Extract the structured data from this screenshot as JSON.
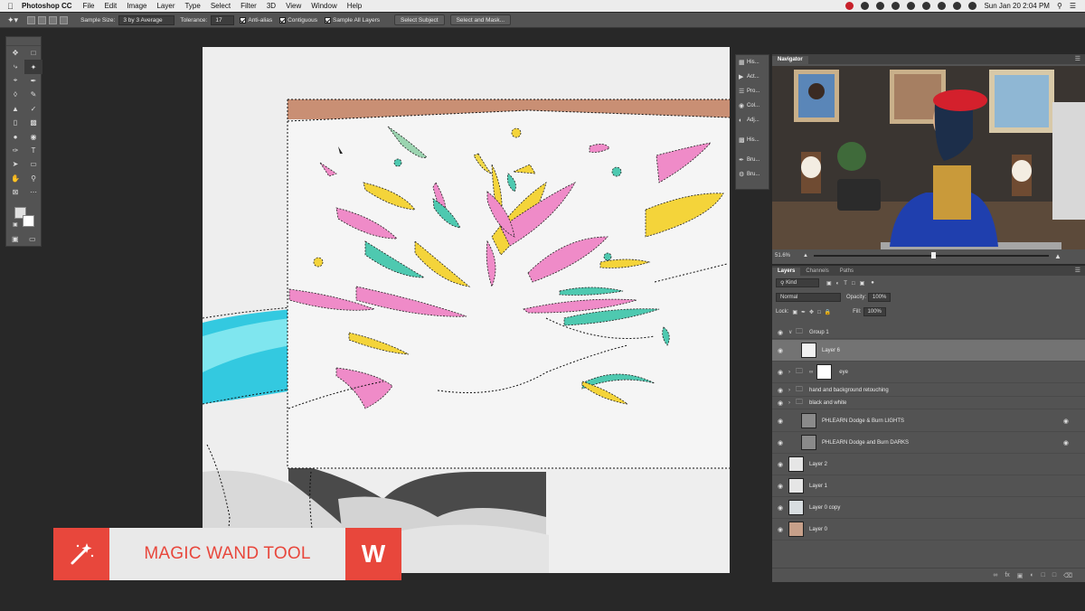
{
  "menubar": {
    "app_name": "Photoshop CC",
    "items": [
      "File",
      "Edit",
      "Image",
      "Layer",
      "Type",
      "Select",
      "Filter",
      "3D",
      "View",
      "Window",
      "Help"
    ],
    "clock": "Sun Jan 20  2:04 PM"
  },
  "options": {
    "sample_size_label": "Sample Size:",
    "sample_size_value": "3 by 3 Average",
    "tolerance_label": "Tolerance:",
    "tolerance_value": "17",
    "anti_alias": "Anti-alias",
    "contiguous": "Contiguous",
    "sample_all_layers": "Sample All Layers",
    "select_subject": "Select Subject",
    "select_and_mask": "Select and Mask..."
  },
  "mini_panels": [
    "His...",
    "Act...",
    "Pro...",
    "Col...",
    "Adj...",
    "His...",
    "Bru...",
    "Bru..."
  ],
  "navigator": {
    "tab": "Navigator",
    "zoom": "51.6%"
  },
  "layers_panel": {
    "tabs": [
      "Layers",
      "Channels",
      "Paths"
    ],
    "kind_label": "Kind",
    "blend_mode": "Normal",
    "opacity_label": "Opacity:",
    "opacity_value": "100%",
    "lock_label": "Lock:",
    "fill_label": "Fill:",
    "fill_value": "100%",
    "layers": [
      {
        "name": "Group 1"
      },
      {
        "name": "Layer 6"
      },
      {
        "name": "eye"
      },
      {
        "name": "hand and background retouching"
      },
      {
        "name": "black and white"
      },
      {
        "name": "PHLEARN Dodge & Burn LIGHTS"
      },
      {
        "name": "PHLEARN Dodge and Burn DARKS"
      },
      {
        "name": "Layer 2"
      },
      {
        "name": "Layer 1"
      },
      {
        "name": "Layer 0 copy"
      },
      {
        "name": "Layer 0"
      }
    ]
  },
  "lower_third": {
    "title": "MAGIC WAND TOOL",
    "shortcut": "W"
  },
  "colors": {
    "accent_red": "#e8473c",
    "panel_gray": "#535353",
    "app_bg": "#282828"
  }
}
